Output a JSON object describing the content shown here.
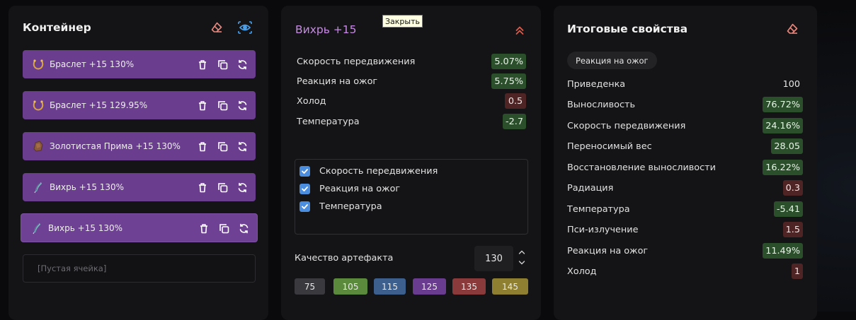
{
  "container": {
    "title": "Контейнер",
    "slots": [
      {
        "label": "Браслет +15  130%",
        "icon": "bracelet-icon"
      },
      {
        "label": "Браслет +15  129.95%",
        "icon": "bracelet-icon"
      },
      {
        "label": "Золотистая Прима +15  130%",
        "icon": "stone-icon"
      },
      {
        "label": "Вихрь +15  130%",
        "icon": "feather-icon"
      },
      {
        "label": "Вихрь +15  130%",
        "icon": "feather-icon"
      }
    ],
    "empty_slot": "[Пустая ячейка]"
  },
  "artifact": {
    "title": "Вихрь +15",
    "tooltip": "Закрыть",
    "stats": [
      {
        "label": "Скорость передвижения",
        "value": "5.07%",
        "type": "pos"
      },
      {
        "label": "Реакция на ожог",
        "value": "5.75%",
        "type": "pos"
      },
      {
        "label": "Холод",
        "value": "0.5",
        "type": "neg"
      },
      {
        "label": "Температура",
        "value": "-2.7",
        "type": "pos"
      }
    ],
    "checkboxes": [
      {
        "label": "Скорость передвижения",
        "checked": true
      },
      {
        "label": "Реакция на ожог",
        "checked": true
      },
      {
        "label": "Температура",
        "checked": true
      }
    ],
    "quality": {
      "label": "Качество артефакта",
      "value": "130"
    },
    "quality_presets": [
      {
        "label": "75",
        "color": "#3a3a3e"
      },
      {
        "label": "105",
        "color": "#5c8a3c"
      },
      {
        "label": "115",
        "color": "#3d5f8e"
      },
      {
        "label": "125",
        "color": "#6a3c8f"
      },
      {
        "label": "135",
        "color": "#8a3a3a"
      },
      {
        "label": "145",
        "color": "#8e8030"
      }
    ]
  },
  "summary": {
    "title": "Итоговые свойства",
    "tag": "Реакция на ожог",
    "stats": [
      {
        "label": "Приведенка",
        "value": "100",
        "type": "neu"
      },
      {
        "label": "Выносливость",
        "value": "76.72%",
        "type": "pos"
      },
      {
        "label": "Скорость передвижения",
        "value": "24.16%",
        "type": "pos"
      },
      {
        "label": "Переносимый вес",
        "value": "28.05",
        "type": "pos"
      },
      {
        "label": "Восстановление выносливости",
        "value": "16.22%",
        "type": "pos"
      },
      {
        "label": "Радиация",
        "value": "0.3",
        "type": "neg"
      },
      {
        "label": "Температура",
        "value": "-5.41",
        "type": "pos"
      },
      {
        "label": "Пси-излучение",
        "value": "1.5",
        "type": "neg"
      },
      {
        "label": "Реакция на ожог",
        "value": "11.49%",
        "type": "pos"
      },
      {
        "label": "Холод",
        "value": "1",
        "type": "neg"
      }
    ]
  },
  "colors": {
    "accent_purple": "#6b3d8f",
    "title_purple": "#c88ae6",
    "eraser": "#e8877d",
    "eye": "#4a9ee8",
    "chevron": "#e05a4a",
    "positive_bg": "#2b4f2b",
    "negative_bg": "#4f2424"
  }
}
